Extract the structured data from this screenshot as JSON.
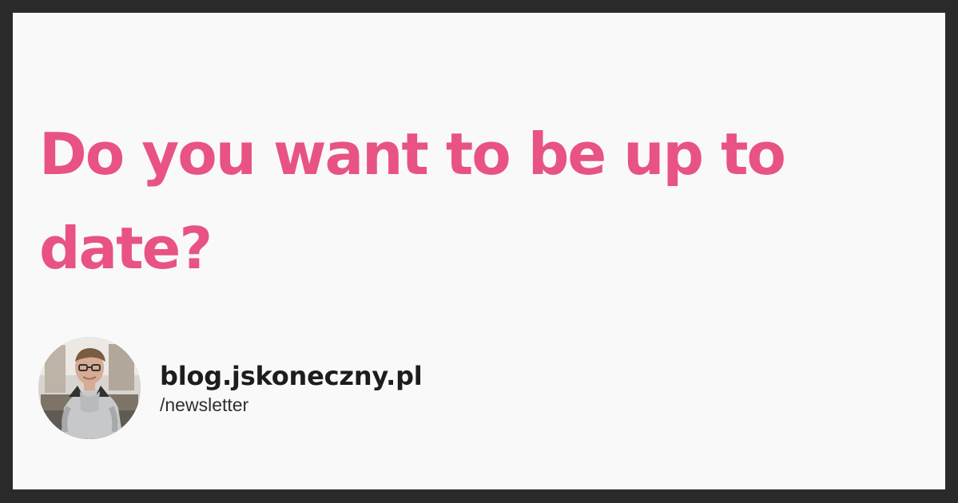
{
  "headline": {
    "text": "Do you want to be up to date?"
  },
  "author": {
    "site": "blog.jskoneczny.pl",
    "path": "/newsletter"
  },
  "colors": {
    "frame": "#2b2a2a",
    "card_background": "#f9f9f9",
    "headline": "#e85383",
    "site_text": "#1d1d1d",
    "path_text": "#2f2f2f"
  }
}
